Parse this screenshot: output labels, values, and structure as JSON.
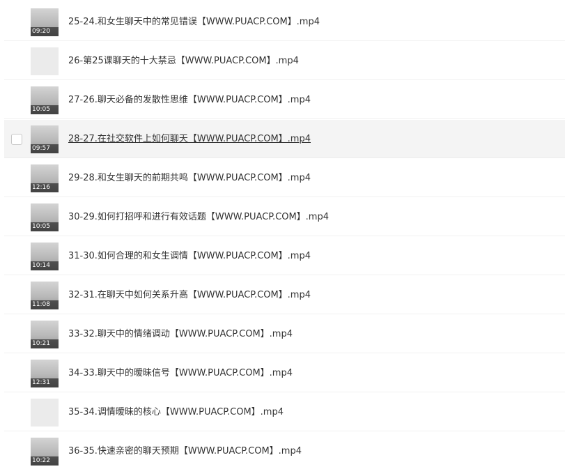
{
  "files": [
    {
      "name": "25-24.和女生聊天中的常见错误【WWW.PUACP.COM】.mp4",
      "duration": "09:20",
      "thumb_icon": "video-thumbnail"
    },
    {
      "name": "26-第25课聊天的十大禁忌【WWW.PUACP.COM】.mp4",
      "duration": "",
      "thumb_icon": "blank-thumbnail"
    },
    {
      "name": "27-26.聊天必备的发散性思维【WWW.PUACP.COM】.mp4",
      "duration": "10:05",
      "thumb_icon": "video-thumbnail"
    },
    {
      "name": "28-27.在社交软件上如何聊天【WWW.PUACP.COM】.mp4",
      "duration": "09:57",
      "thumb_icon": "video-thumbnail",
      "hovered": true
    },
    {
      "name": "29-28.和女生聊天的前期共鸣【WWW.PUACP.COM】.mp4",
      "duration": "12:16",
      "thumb_icon": "video-thumbnail"
    },
    {
      "name": "30-29.如何打招呼和进行有效话题【WWW.PUACP.COM】.mp4",
      "duration": "10:05",
      "thumb_icon": "video-thumbnail"
    },
    {
      "name": "31-30.如何合理的和女生调情【WWW.PUACP.COM】.mp4",
      "duration": "10:14",
      "thumb_icon": "video-thumbnail"
    },
    {
      "name": "32-31.在聊天中如何关系升高【WWW.PUACP.COM】.mp4",
      "duration": "11:08",
      "thumb_icon": "video-thumbnail"
    },
    {
      "name": "33-32.聊天中的情绪调动【WWW.PUACP.COM】.mp4",
      "duration": "10:21",
      "thumb_icon": "video-thumbnail"
    },
    {
      "name": "34-33.聊天中的暧昧信号【WWW.PUACP.COM】.mp4",
      "duration": "12:31",
      "thumb_icon": "video-thumbnail"
    },
    {
      "name": "35-34.调情暧昧的核心【WWW.PUACP.COM】.mp4",
      "duration": "",
      "thumb_icon": "blank-thumbnail"
    },
    {
      "name": "36-35.快速亲密的聊天预期【WWW.PUACP.COM】.mp4",
      "duration": "10:22",
      "thumb_icon": "video-thumbnail"
    }
  ]
}
